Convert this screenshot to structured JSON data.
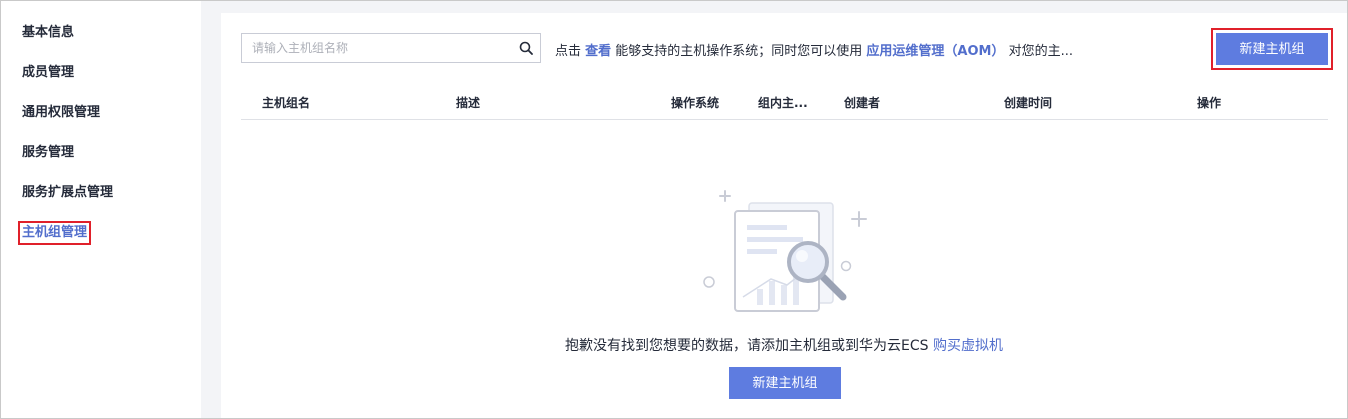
{
  "sidebar": {
    "items": [
      {
        "label": "基本信息"
      },
      {
        "label": "成员管理"
      },
      {
        "label": "通用权限管理"
      },
      {
        "label": "服务管理"
      },
      {
        "label": "服务扩展点管理"
      },
      {
        "label": "主机组管理"
      }
    ]
  },
  "search": {
    "placeholder": "请输入主机组名称",
    "icon": "search-icon"
  },
  "tip": {
    "prefix": "点击 ",
    "link1": "查看",
    "middle": " 能够支持的主机操作系统；同时您可以使用 ",
    "link2": "应用运维管理（AOM）",
    "suffix": " 对您的主..."
  },
  "toolbar": {
    "create_label": "新建主机组"
  },
  "table": {
    "columns": [
      "主机组名",
      "描述",
      "操作系统",
      "组内主...",
      "创建者",
      "创建时间",
      "操作"
    ]
  },
  "empty": {
    "illustration": "search-document-illustration",
    "message": "抱歉没有找到您想要的数据，请添加主机组或到华为云ECS ",
    "link": "购买虚拟机",
    "button_label": "新建主机组"
  },
  "colors": {
    "accent": "#5e7ce0",
    "link": "#526ecc",
    "highlight_border": "#e0202a"
  }
}
